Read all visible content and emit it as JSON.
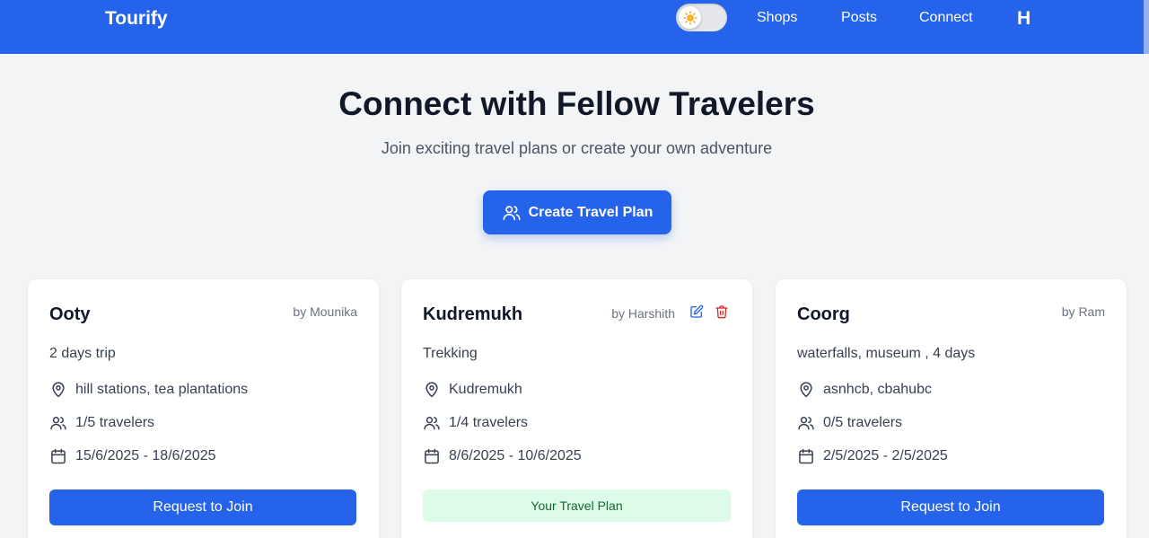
{
  "header": {
    "brand": "Tourify",
    "nav": {
      "shops": "Shops",
      "posts": "Posts",
      "connect": "Connect"
    },
    "avatar_initial": "H",
    "theme_toggle_icon": "sun-icon"
  },
  "hero": {
    "title": "Connect with Fellow Travelers",
    "subtitle": "Join exciting travel plans or create your own adventure",
    "create_button": "Create Travel Plan"
  },
  "colors": {
    "primary": "#2563eb",
    "success_bg": "#dcfce7",
    "success_text": "#166534",
    "edit_icon": "#2563eb",
    "delete_icon": "#dc2626"
  },
  "cards": [
    {
      "title": "Ooty",
      "author": "by Mounika",
      "description": "2 days trip",
      "location": "hill stations, tea plantations",
      "travelers": "1/5 travelers",
      "dates": "15/6/2025 - 18/6/2025",
      "action": "Request to Join"
    },
    {
      "title": "Kudremukh",
      "author": "by Harshith",
      "description": "Trekking",
      "location": "Kudremukh",
      "travelers": "1/4 travelers",
      "dates": "8/6/2025 - 10/6/2025",
      "action": "Your Travel Plan"
    },
    {
      "title": "Coorg",
      "author": "by Ram",
      "description": "waterfalls, museum , 4 days",
      "location": "asnhcb, cbahubc",
      "travelers": "0/5 travelers",
      "dates": "2/5/2025 - 2/5/2025",
      "action": "Request to Join"
    }
  ]
}
